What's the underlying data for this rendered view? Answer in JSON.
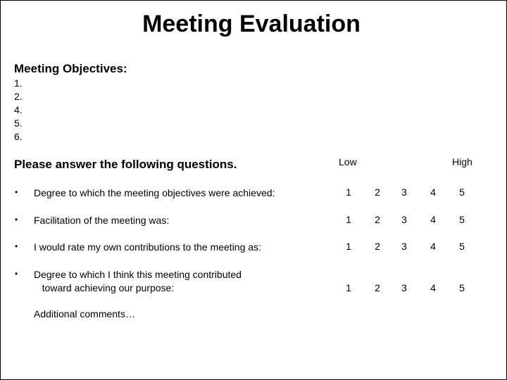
{
  "title": "Meeting Evaluation",
  "objectives": {
    "heading": "Meeting Objectives:",
    "items": [
      "1.",
      "2.",
      "4.",
      "5.",
      "6."
    ]
  },
  "questions_section": {
    "heading": "Please answer the following questions.",
    "scale_low_label": "Low",
    "scale_high_label": "High",
    "bullet": "•",
    "questions": [
      {
        "text": "Degree to which the meeting objectives were achieved:",
        "ratings": [
          "1",
          "2",
          "3",
          "4",
          "5"
        ]
      },
      {
        "text": "Facilitation of the meeting was:",
        "ratings": [
          "1",
          "2",
          "3",
          "4",
          "5"
        ]
      },
      {
        "text": "I would rate my own contributions to the meeting as:",
        "ratings": [
          "1",
          "2",
          "3",
          "4",
          "5"
        ]
      },
      {
        "text": "Degree to which I think this meeting contributed\n   toward achieving our purpose:",
        "ratings": [
          "1",
          "2",
          "3",
          "4",
          "5"
        ]
      }
    ]
  },
  "additional_comments_label": "Additional  comments…"
}
